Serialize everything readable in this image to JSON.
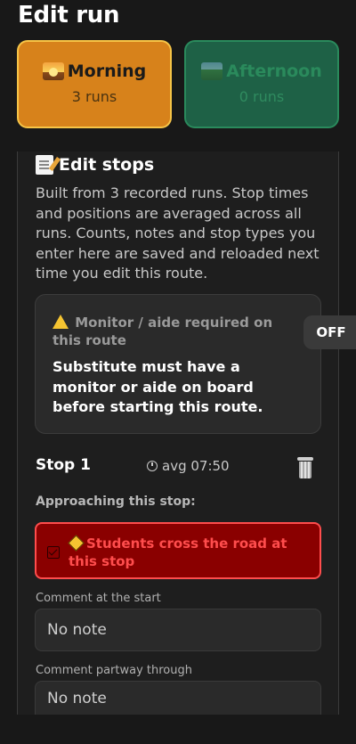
{
  "page": {
    "title": "Edit run"
  },
  "runs": [
    {
      "name": "Morning",
      "count": "3 runs",
      "icon": "sunrise-icon",
      "selected": true
    },
    {
      "name": "Afternoon",
      "count": "0 runs",
      "icon": "park-icon",
      "selected": false
    }
  ],
  "edit_stops": {
    "title": "Edit stops",
    "description": "Built from 3 recorded runs. Stop times and positions are averaged across all runs. Counts, notes and stop types you enter here are saved and reloaded next time you edit this route."
  },
  "monitor": {
    "label": "Monitor / aide required on this route",
    "text": "Substitute must have a monitor or aide on board before starting this route.",
    "toggle": "OFF"
  },
  "stop": {
    "title": "Stop 1",
    "avg_time": "avg 07:50",
    "approaching_label": "Approaching this stop:",
    "cross_road": "Students cross the road at this stop",
    "cross_road_checked": true,
    "comment_start_label": "Comment at the start",
    "comment_start_placeholder": "No note",
    "comment_partway_label": "Comment partway through",
    "comment_partway_placeholder": "No note"
  },
  "colors": {
    "morning_bg": "#d7821b",
    "afternoon_bg": "#1e6146",
    "alert_bg": "#8a0000",
    "alert_text": "#ff4d4d"
  }
}
